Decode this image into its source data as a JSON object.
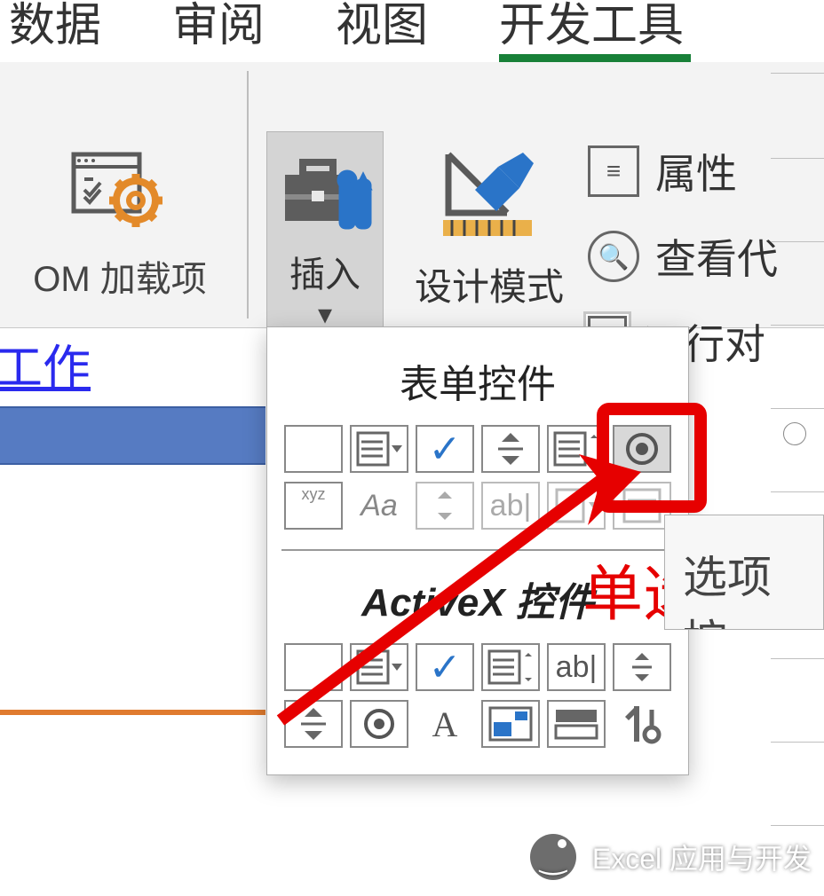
{
  "ribbon_tabs": {
    "data": "数据",
    "review": "审阅",
    "view": "视图",
    "developer": "开发工具"
  },
  "com_addins": {
    "label": "OM 加载项"
  },
  "insert_button": {
    "label": "插入"
  },
  "design_mode": {
    "label": "设计模式"
  },
  "right_column": {
    "properties": "属性",
    "view_code": "查看代",
    "run_dialog": "运行对"
  },
  "dropdown": {
    "section_form": "表单控件",
    "section_activex": "ActiveX 控件",
    "form_controls": [
      {
        "name": "button-control-icon"
      },
      {
        "name": "combo-box-control-icon"
      },
      {
        "name": "checkbox-control-icon"
      },
      {
        "name": "spin-button-control-icon"
      },
      {
        "name": "list-box-control-icon"
      },
      {
        "name": "option-button-control-icon",
        "highlighted": true
      },
      {
        "name": "group-box-control-icon",
        "label": "xyz"
      },
      {
        "name": "label-control-icon",
        "label": "Aa"
      },
      {
        "name": "scrollbar-control-icon"
      },
      {
        "name": "textfield-disabled-icon",
        "label": "ab|"
      },
      {
        "name": "combo-disabled-icon"
      },
      {
        "name": "list-disabled-icon"
      }
    ],
    "activex_controls": [
      {
        "name": "command-button-ax-icon"
      },
      {
        "name": "combo-box-ax-icon"
      },
      {
        "name": "checkbox-ax-icon"
      },
      {
        "name": "list-box-ax-icon"
      },
      {
        "name": "text-box-ax-icon",
        "label": "ab|"
      },
      {
        "name": "scrollbar-ax-icon"
      },
      {
        "name": "spin-button-ax-icon"
      },
      {
        "name": "option-button-ax-icon"
      },
      {
        "name": "label-ax-icon",
        "label": "A"
      },
      {
        "name": "image-ax-icon"
      },
      {
        "name": "toggle-ax-icon"
      },
      {
        "name": "more-controls-ax-icon"
      }
    ]
  },
  "annotation": {
    "label": "单选框",
    "tooltip_partial": "选项按"
  },
  "sheet": {
    "title_partial": "发工作"
  },
  "watermark": "Excel 应用与开发"
}
